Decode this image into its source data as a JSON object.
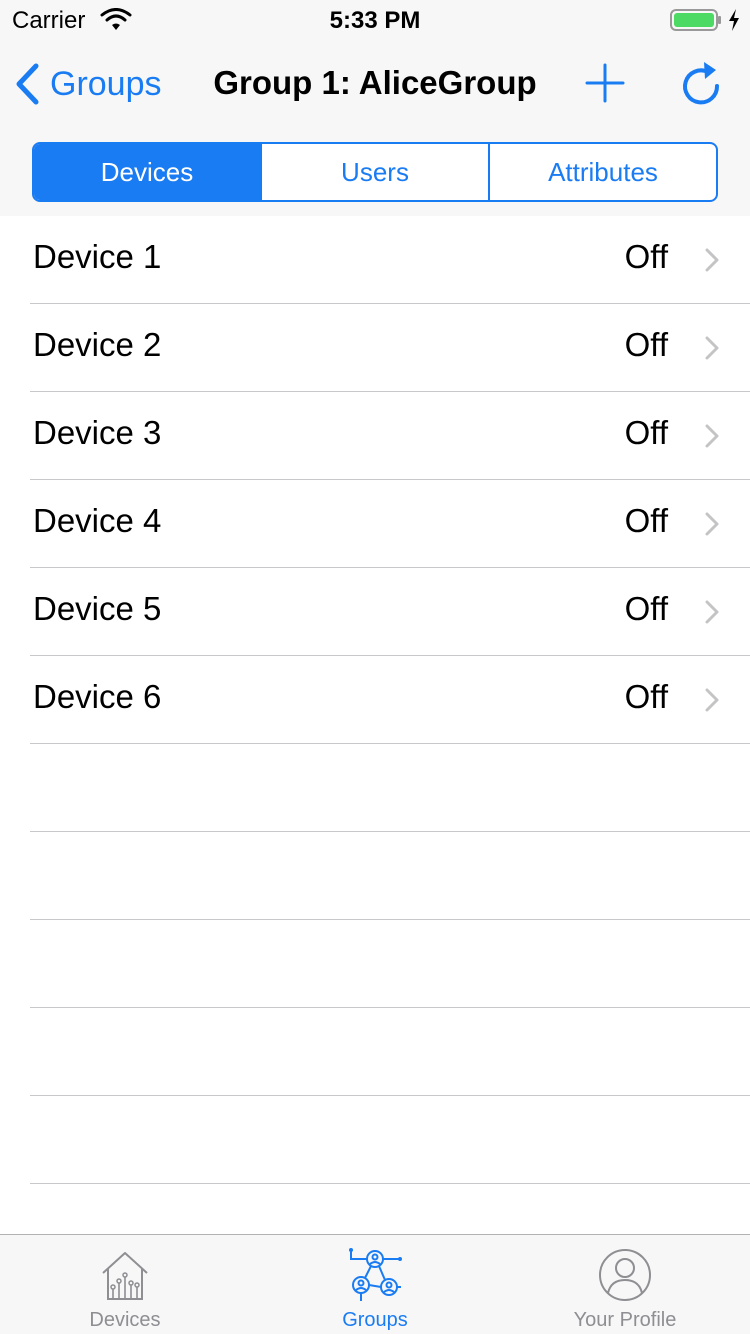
{
  "status_bar": {
    "carrier": "Carrier",
    "time": "5:33 PM",
    "icons": [
      "wifi-icon",
      "battery-icon",
      "charging-bolt-icon"
    ],
    "battery_color": "#4cd964"
  },
  "nav": {
    "back_label": "Groups",
    "title": "Group 1: AliceGroup",
    "icons": [
      "back-chevron-icon",
      "plus-icon",
      "refresh-icon"
    ]
  },
  "segments": [
    {
      "label": "Devices",
      "selected": true
    },
    {
      "label": "Users",
      "selected": false
    },
    {
      "label": "Attributes",
      "selected": false
    }
  ],
  "devices": [
    {
      "name": "Device 1",
      "status": "Off"
    },
    {
      "name": "Device 2",
      "status": "Off"
    },
    {
      "name": "Device 3",
      "status": "Off"
    },
    {
      "name": "Device 4",
      "status": "Off"
    },
    {
      "name": "Device 5",
      "status": "Off"
    },
    {
      "name": "Device 6",
      "status": "Off"
    }
  ],
  "tabs": [
    {
      "label": "Devices",
      "icon": "house-circuit-icon",
      "selected": false
    },
    {
      "label": "Groups",
      "icon": "group-network-icon",
      "selected": true
    },
    {
      "label": "Your Profile",
      "icon": "profile-icon",
      "selected": false
    }
  ],
  "colors": {
    "accent": "#1a7cf2",
    "inactive_tab": "#8e8e93",
    "separator": "#c8c7cc",
    "bar_background": "#f7f7f7"
  }
}
